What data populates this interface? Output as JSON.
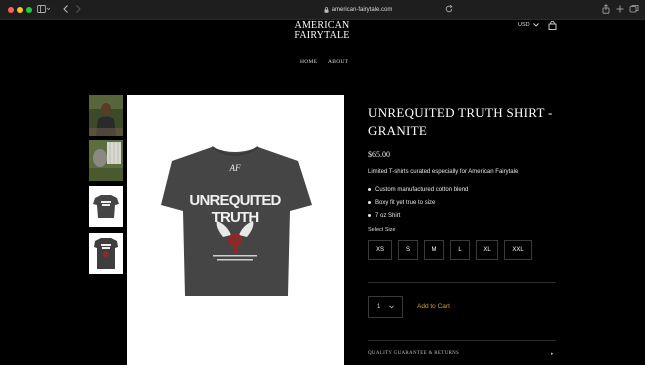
{
  "browser": {
    "url": "american-fairytale.com"
  },
  "header": {
    "logo_line1": "AMERICAN",
    "logo_line2": "FAIRYTALE",
    "currency": "USD",
    "nav": [
      {
        "label": "HOME"
      },
      {
        "label": "ABOUT"
      }
    ]
  },
  "product": {
    "title": "UNREQUITED TRUTH SHIRT - GRANITE",
    "price": "$65.00",
    "description": "Limited T-shirts curated especially for American Fairytale",
    "bullets": [
      "Custom manufactured cotton blend",
      "Boxy fit yet true to size",
      "7 oz Shirt"
    ],
    "size_label": "Select Size",
    "sizes": [
      "XS",
      "S",
      "M",
      "L",
      "XL",
      "XXL"
    ],
    "quantity": "1",
    "add_to_cart": "Add to Cart",
    "quality_guarantee": "QUALITY GUARANTEE & RETURNS",
    "shirt_print_line1": "UNREQUITED",
    "shirt_print_line2": "TRUTH",
    "shirt_logo": "AF"
  },
  "colors": {
    "background": "#000000",
    "accent": "#c9a23f",
    "shirt": "#454545"
  }
}
